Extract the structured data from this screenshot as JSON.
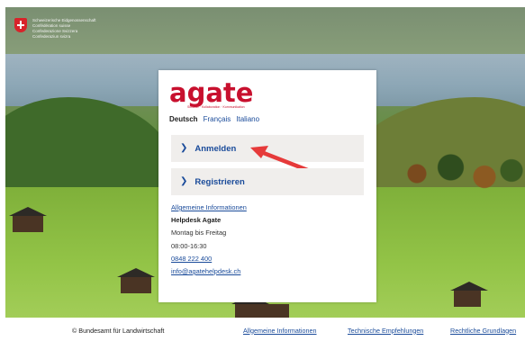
{
  "government": {
    "lines": [
      "Schweizerische Eidgenossenschaft",
      "Confédération suisse",
      "Confederazione Svizzera",
      "Confederaziun svizra"
    ]
  },
  "brand": {
    "name": "agate",
    "tagline": "Schalter · Kollaboration · Kommunikation"
  },
  "languages": [
    "Deutsch",
    "Français",
    "Italiano"
  ],
  "actions": {
    "login_label": "Anmelden",
    "register_label": "Registrieren"
  },
  "info": {
    "general_link": "Allgemeine Informationen",
    "helpdesk_title": "Helpdesk Agate",
    "days": "Montag bis Freitag",
    "hours": "08:00-16:30",
    "phone": "0848 222 400",
    "email": "info@agatehelpdesk.ch"
  },
  "footer": {
    "copyright": "© Bundesamt für Landwirtschaft",
    "links": [
      "Allgemeine Informationen",
      "Technische Empfehlungen",
      "Rechtliche Grundlagen"
    ]
  },
  "colors": {
    "brand_red": "#c8102e",
    "link_blue": "#1a4b9a",
    "annotation_arrow": "#e63a3a"
  }
}
